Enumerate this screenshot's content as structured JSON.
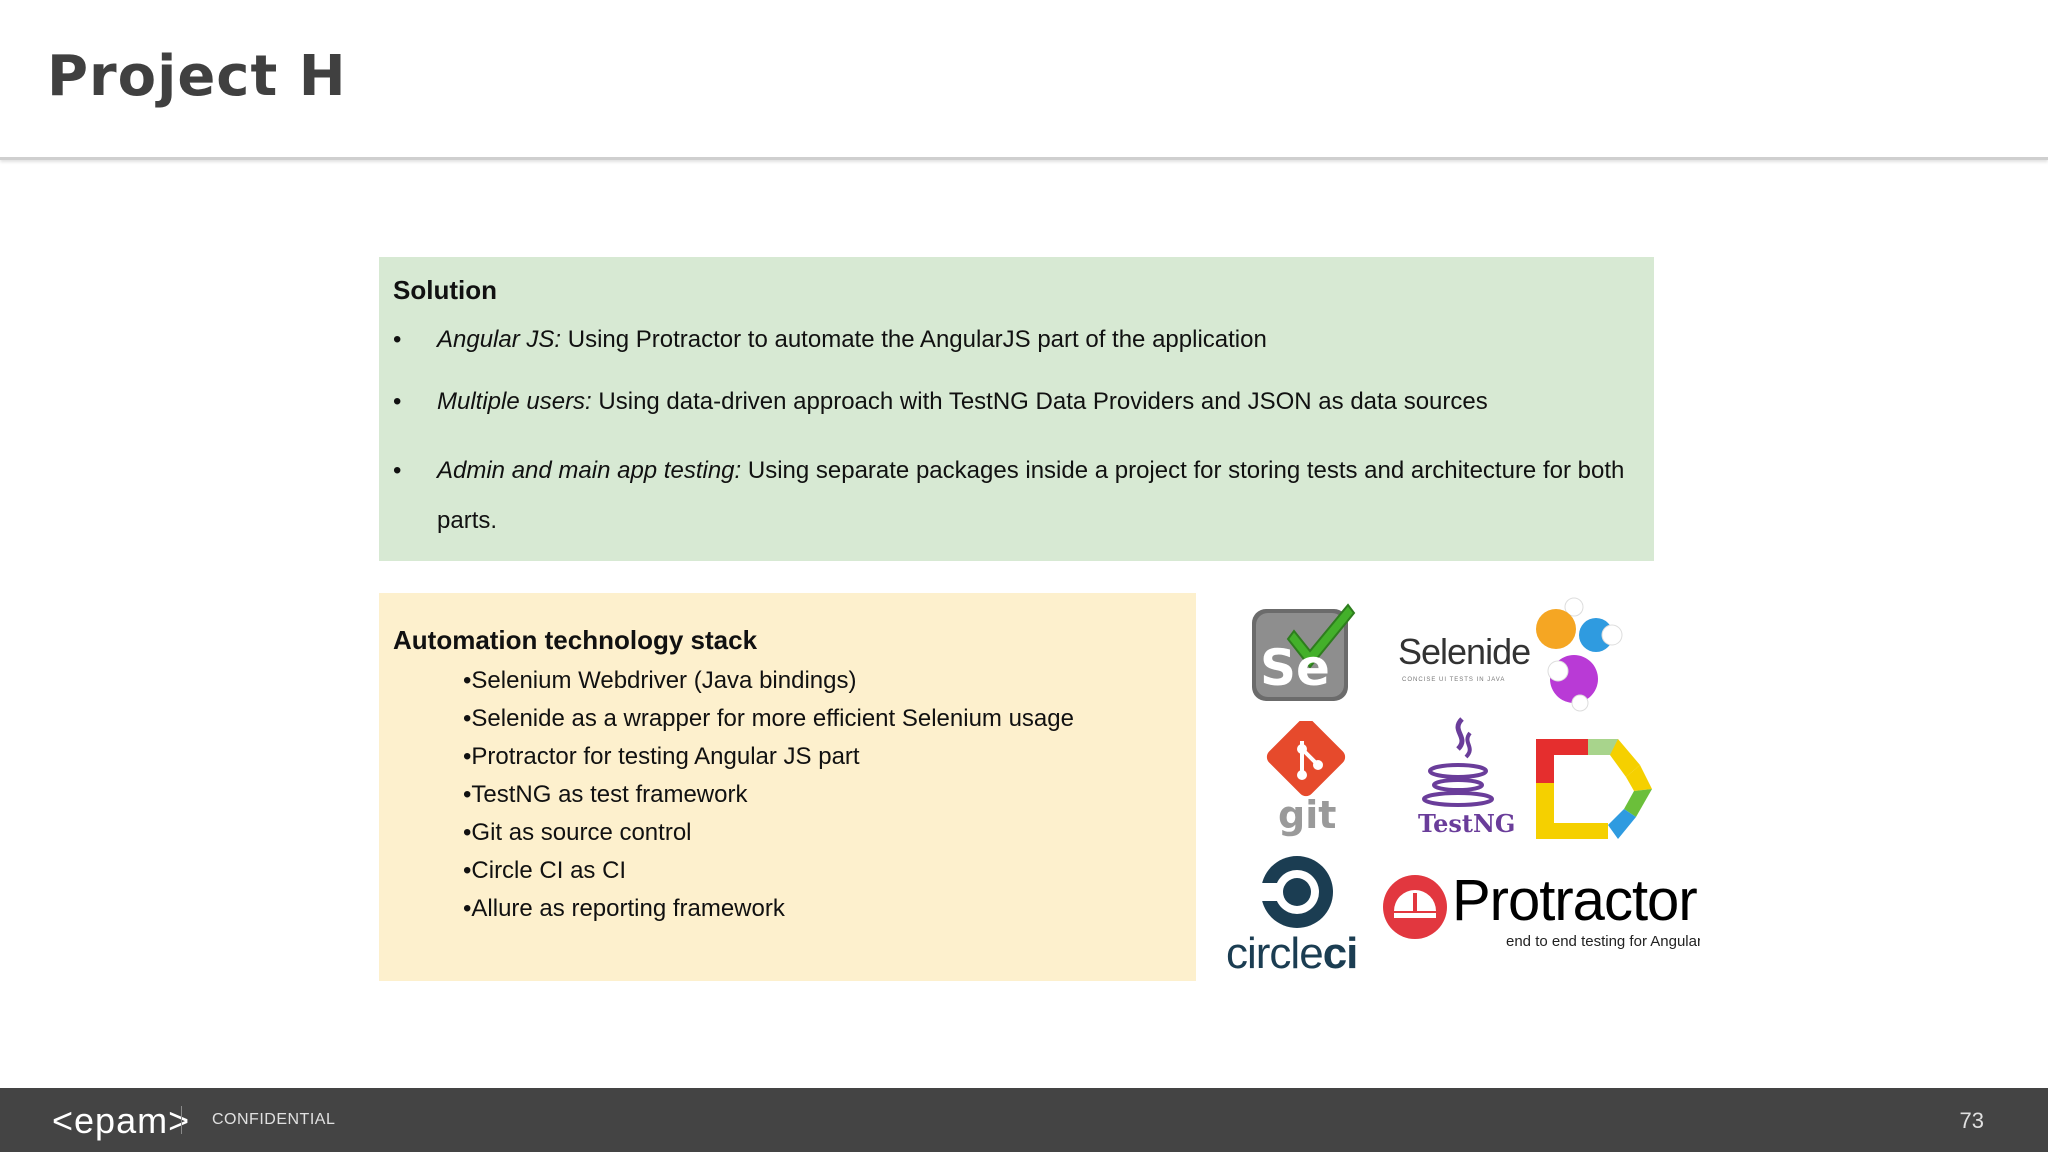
{
  "slide": {
    "title": "Project H",
    "page_number": "73"
  },
  "solution": {
    "heading": "Solution",
    "bullet_glyph": "•",
    "items": [
      {
        "lead": "Angular JS:",
        "text": " Using Protractor to automate the AngularJS part of the application"
      },
      {
        "lead": "Multiple users:",
        "text": " Using data-driven approach with TestNG Data Providers and JSON as data sources"
      },
      {
        "lead": "Admin and main app testing:",
        "text": " Using separate packages inside a project for storing tests and architecture for both parts."
      }
    ]
  },
  "stack": {
    "heading": "Automation technology stack",
    "items": [
      "•Selenium Webdriver  (Java bindings)",
      "•Selenide as a wrapper for more efficient Selenium usage",
      "•Protractor for testing Angular JS part",
      "•TestNG as test framework",
      "•Git as source control",
      "•Circle CI as CI",
      "•Allure as reporting framework"
    ]
  },
  "logos": {
    "selenium": "Se",
    "selenide": "Selenide",
    "selenide_tagline": "CONCISE UI TESTS IN JAVA",
    "git": "git",
    "testng": "TestNG",
    "circleci_a": "circle",
    "circleci_b": "ci",
    "protractor": "Protractor",
    "protractor_tagline": "end to end testing for AngularJS"
  },
  "footer": {
    "logo": "<epam>",
    "confidential": "CONFIDENTIAL"
  },
  "colors": {
    "solution_bg": "#d7e9d3",
    "stack_bg": "#fdf0cd",
    "footer_bg": "#444444",
    "title": "#404040"
  }
}
